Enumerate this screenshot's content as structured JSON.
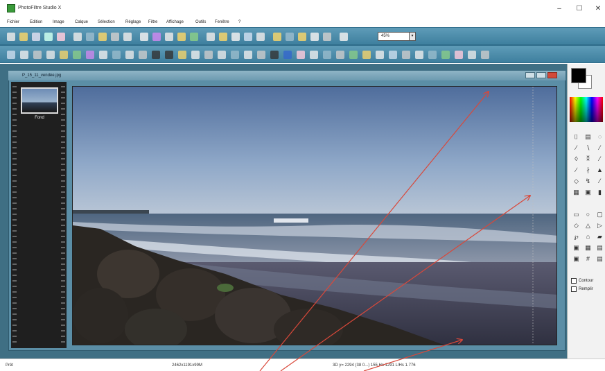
{
  "app": {
    "title": "PhotoFiltre Studio X"
  },
  "window_controls": {
    "minimize": "–",
    "maximize": "☐",
    "close": "✕"
  },
  "menu": [
    "Fichier",
    "Edition",
    "Image",
    "Calque",
    "Sélection",
    "Réglage",
    "Filtre",
    "Affichage",
    "Outils",
    "Fenêtre",
    "?"
  ],
  "toolbar": {
    "zoom_value": "45%"
  },
  "document": {
    "title": "P_15_11_vendée.jpg",
    "layer_name": "Fond"
  },
  "options": {
    "contour_label": "Contour",
    "remplir_label": "Remplir"
  },
  "status": {
    "state": "Prêt",
    "dimensions": "2462x1191x99M",
    "coords": "3D y= 2294 (38 0...) 155 Hs 1291 L/Hs 1.776"
  },
  "colors": {
    "accent": "#3e7f9e",
    "annotation": "#d9483a"
  }
}
